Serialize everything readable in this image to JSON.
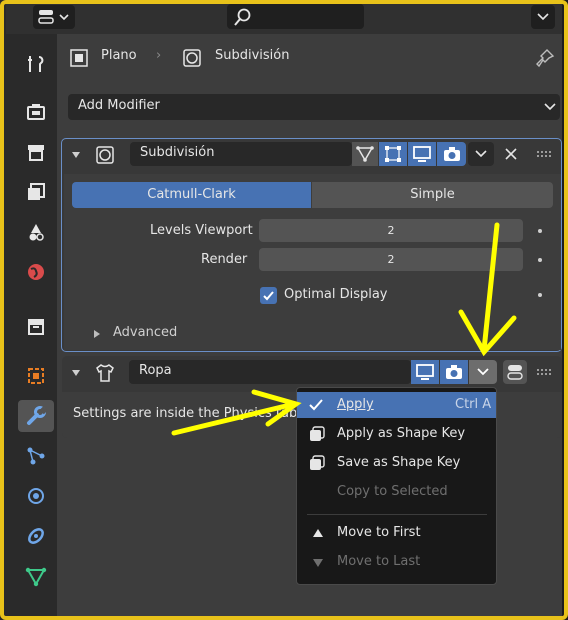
{
  "breadcrumb": {
    "object": "Plano",
    "modifier": "Subdivisión"
  },
  "add_modifier": "Add Modifier",
  "subdivision": {
    "name": "Subdivisión",
    "tabs": [
      "Catmull-Clark",
      "Simple"
    ],
    "levels_viewport_label": "Levels Viewport",
    "levels_viewport_value": "2",
    "render_label": "Render",
    "render_value": "2",
    "optimal_display_label": "Optimal Display",
    "advanced_label": "Advanced"
  },
  "cloth": {
    "name": "Ropa",
    "info_text": "Settings are inside the Physics tab"
  },
  "dropdown": {
    "apply": {
      "label": "Apply",
      "shortcut": "Ctrl A"
    },
    "apply_as_shape_key": "Apply as Shape Key",
    "save_as_shape_key": "Save as Shape Key",
    "copy_to_selected": "Copy to Selected",
    "move_to_first": "Move to First",
    "move_to_last": "Move to Last"
  },
  "colors": {
    "accent_blue": "#4772b3",
    "annotation_yellow": "#ffff00",
    "frame_yellow": "#e8c21a",
    "panel_bg": "#3d3d3d"
  },
  "icons": [
    "editor-type-icon",
    "search-icon",
    "chevron-down-icon",
    "tool-icon",
    "render-icon",
    "output-icon",
    "view-layer-icon",
    "scene-icon",
    "world-icon",
    "collection-icon",
    "object-icon",
    "wrench-icon",
    "particles-icon",
    "physics-icon",
    "constraints-icon",
    "data-icon",
    "pin-icon",
    "object-square-icon",
    "subdivision-icon",
    "filter-icon",
    "edit-mode-icon",
    "monitor-icon",
    "camera-icon",
    "close-icon",
    "drag-handle-icon",
    "shirt-icon",
    "toggle-icon",
    "check-icon",
    "shape-key-icon",
    "triangle-up-icon",
    "triangle-down-icon"
  ]
}
